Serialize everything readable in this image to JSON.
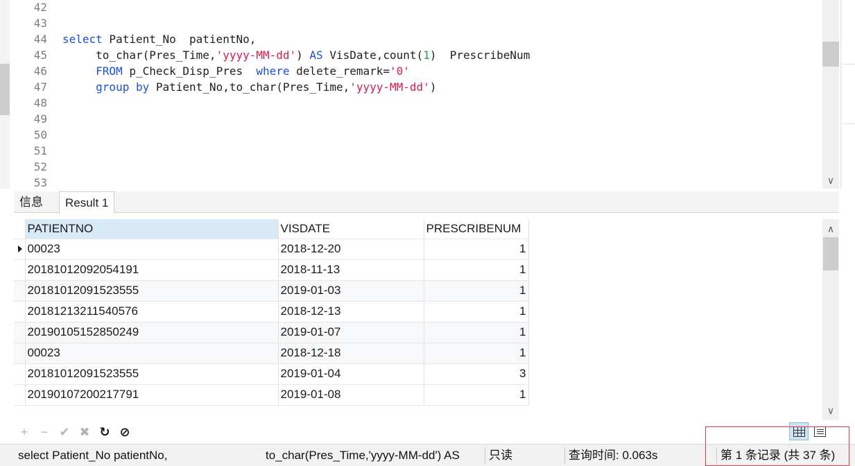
{
  "editor": {
    "line_numbers": [
      "42",
      "43",
      "44",
      "45",
      "46",
      "47",
      "48",
      "49",
      "50",
      "51",
      "52",
      "53"
    ],
    "code": {
      "l44_kw": "select",
      "l44_rest": " Patient_No  patientNo,",
      "l45_a": "     to_char(Pres_Time,",
      "l45_str": "'yyyy-MM-dd'",
      "l45_b": ") ",
      "l45_kw": "AS",
      "l45_c": " VisDate,count(",
      "l45_num": "1",
      "l45_d": ")  PrescribeNum",
      "l46_kw1": "     FROM",
      "l46_a": " p_Check_Disp_Pres  ",
      "l46_kw2": "where",
      "l46_b": " delete_remark=",
      "l46_str": "'0'",
      "l47_kw": "     group by",
      "l47_a": " Patient_No,to_char(Pres_Time,",
      "l47_str": "'yyyy-MM-dd'",
      "l47_b": ")"
    }
  },
  "tabs": [
    {
      "label": "信息"
    },
    {
      "label": "Result 1"
    }
  ],
  "grid": {
    "columns": [
      "PATIENTNO",
      "VISDATE",
      "PRESCRIBENUM"
    ],
    "rows": [
      [
        "00023",
        "2018-12-20",
        "1"
      ],
      [
        "20181012092054191",
        "2018-11-13",
        "1"
      ],
      [
        "20181012091523555",
        "2019-01-03",
        "1"
      ],
      [
        "20181213211540576",
        "2018-12-13",
        "1"
      ],
      [
        "20190105152850249",
        "2019-01-07",
        "1"
      ],
      [
        "00023",
        "2018-12-18",
        "1"
      ],
      [
        "20181012091523555",
        "2019-01-04",
        "3"
      ],
      [
        "20190107200217791",
        "2019-01-08",
        "1"
      ]
    ]
  },
  "toolbar": {
    "add": "+",
    "remove": "−",
    "apply": "✔",
    "cancel": "✖",
    "refresh": "↻",
    "stop": "⊘"
  },
  "icons": {
    "add": "plus-icon",
    "remove": "minus-icon",
    "apply": "check-icon",
    "cancel": "cross-icon",
    "refresh": "refresh-icon",
    "stop": "stop-icon",
    "grid_view": "grid-view-icon",
    "form_view": "form-view-icon"
  },
  "status": {
    "sql_part1": "select Patient_No  patientNo,",
    "sql_part2": "to_char(Pres_Time,'yyyy-MM-dd') AS",
    "readonly": "只读",
    "query_time": "查询时间: 0.063s",
    "record": "第 1 条记录 (共 37 条)"
  },
  "colors": {
    "keyword": "#1a4fd6",
    "string": "#d81b4a",
    "number": "#1e9e4a",
    "selected_header": "#d8e9f7",
    "highlight_box": "#e03b3b"
  }
}
